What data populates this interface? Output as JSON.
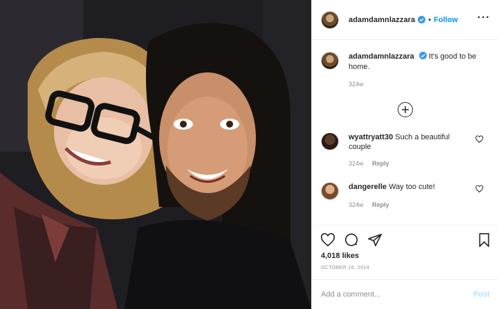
{
  "post": {
    "username": "adamdamnlazzara",
    "follow_label": "Follow",
    "separator": "•",
    "more_icon": "more-horizontal-icon"
  },
  "caption": {
    "username": "adamdamnlazzara",
    "text": "It's good to be home.",
    "age": "324w"
  },
  "comments": [
    {
      "username": "wyattryatt30",
      "text": "Such a beautiful couple",
      "age": "324w",
      "reply_label": "Reply"
    },
    {
      "username": "dangerelle",
      "text": "Way too cute!",
      "age": "324w",
      "reply_label": "Reply"
    }
  ],
  "actions": {
    "likes": "4,018 likes",
    "date": "OCTOBER 16, 2014"
  },
  "comment_box": {
    "placeholder": "Add a comment...",
    "post_label": "Post"
  },
  "colors": {
    "link_blue": "#0095f6",
    "muted_gray": "#8e8e8e",
    "post_disabled": "#b2dffc"
  }
}
